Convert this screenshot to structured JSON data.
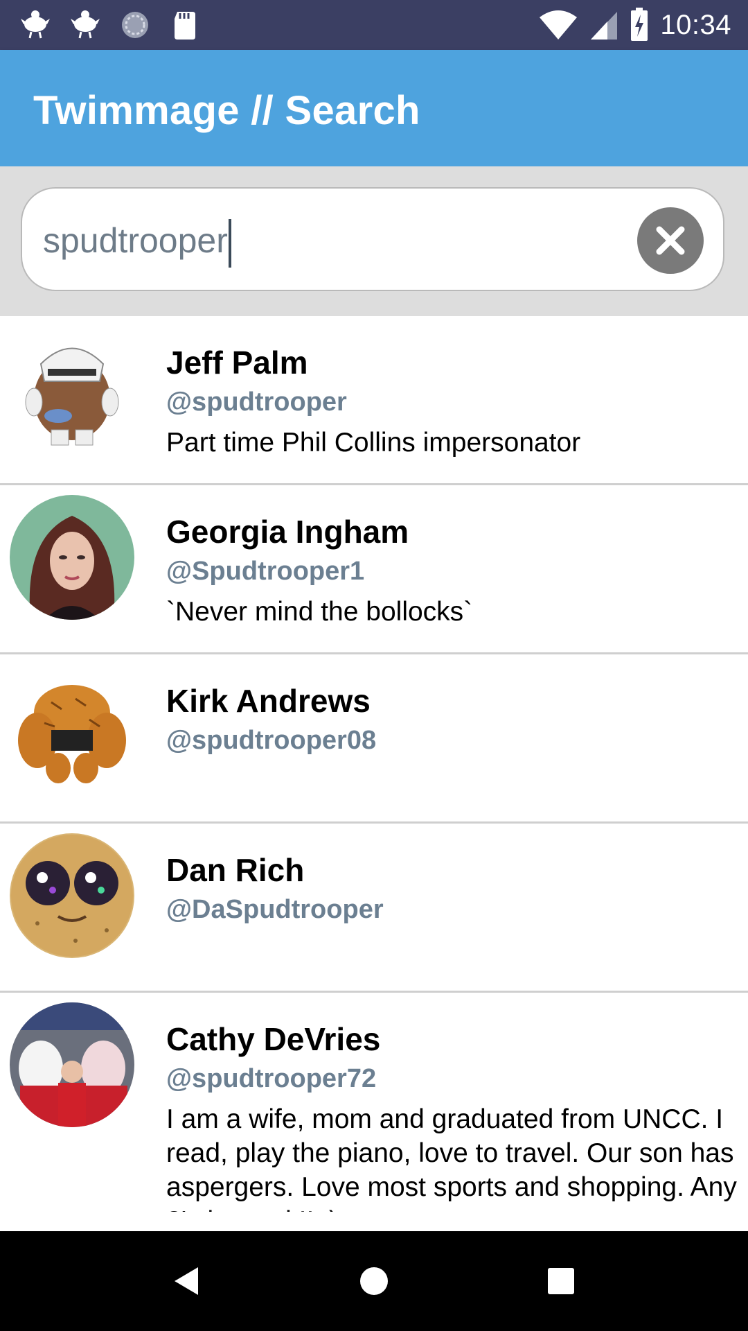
{
  "status_bar": {
    "time": "10:34",
    "left_icons": [
      "bird-icon",
      "bird-icon",
      "sync-icon",
      "sd-card-icon"
    ],
    "right_icons": [
      "wifi-icon",
      "cell-signal-icon",
      "battery-charging-icon"
    ]
  },
  "app_bar": {
    "title": "Twimmage // Search"
  },
  "search": {
    "value": "spudtrooper",
    "clear_icon": "clear-icon"
  },
  "results": [
    {
      "name": "Jeff Palm",
      "handle": "@spudtrooper",
      "bio": "Part time Phil Collins impersonator"
    },
    {
      "name": "Georgia Ingham",
      "handle": "@Spudtrooper1",
      "bio": "`Never mind the bollocks`"
    },
    {
      "name": "Kirk Andrews",
      "handle": "@spudtrooper08",
      "bio": ""
    },
    {
      "name": "Dan Rich",
      "handle": "@DaSpudtrooper",
      "bio": ""
    },
    {
      "name": "Cathy DeVries",
      "handle": "@spudtrooper72",
      "bio": "I am a wife, mom and graduated from UNCC. I read, play the piano, love to travel. Our son has aspergers. Love most sports and shopping. Any ?'s just ask!! :)"
    }
  ],
  "nav_bar": {
    "icons": [
      "back-icon",
      "home-icon",
      "recents-icon"
    ]
  },
  "colors": {
    "status_bar": "#3b3f63",
    "app_bar": "#4ea3de",
    "handle": "#6b7f91",
    "divider": "#cfcfcf"
  }
}
